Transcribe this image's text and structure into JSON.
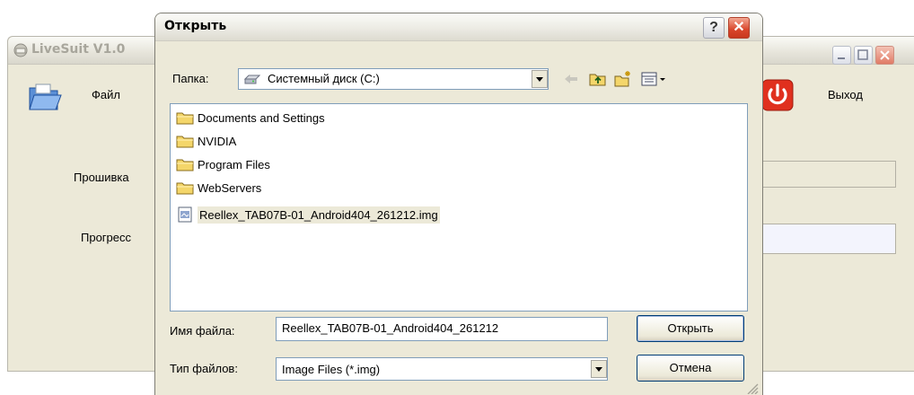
{
  "background_window": {
    "title": "LiveSuit V1.0",
    "file_button_label": "Файл",
    "exit_button_label": "Выход",
    "firmware_label": "Прошивка",
    "progress_label": "Прогресс",
    "colors": {
      "face": "#ece9d8",
      "exit_red": "#e0301e"
    }
  },
  "dialog": {
    "title": "Открыть",
    "help_label": "?",
    "close_label": "✕",
    "folder_label": "Папка:",
    "folder_value": "Системный диск (C:)",
    "toolbar": {
      "back_icon": "back-arrow-icon",
      "up_icon": "up-folder-icon",
      "new_folder_icon": "new-folder-icon",
      "views_icon": "views-menu-icon"
    },
    "files": [
      {
        "name": "Documents and Settings",
        "type": "folder"
      },
      {
        "name": "NVIDIA",
        "type": "folder"
      },
      {
        "name": "Program Files",
        "type": "folder"
      },
      {
        "name": "WebServers",
        "type": "folder"
      },
      {
        "name": "Reellex_TAB07B-01_Android404_261212.img",
        "type": "file",
        "selected": true
      }
    ],
    "filename_label": "Имя файла:",
    "filename_value": "Reellex_TAB07B-01_Android404_261212",
    "filetype_label": "Тип файлов:",
    "filetype_value": "Image Files (*.img)",
    "open_button": "Открыть",
    "cancel_button": "Отмена",
    "colors": {
      "folder": "#f4d66a",
      "selection": "#ece9d8",
      "field_border": "#7f9db9"
    }
  }
}
